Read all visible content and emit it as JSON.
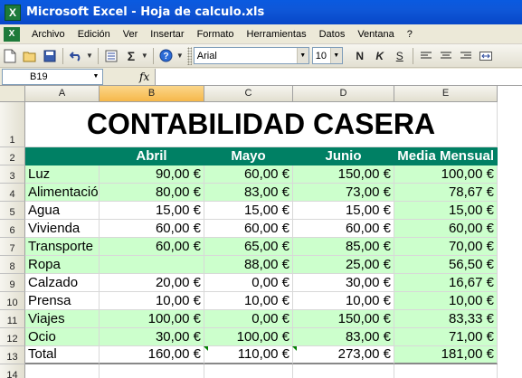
{
  "window": {
    "title": "Microsoft Excel - Hoja de calculo.xls",
    "app_icon": "X"
  },
  "menu": [
    "Archivo",
    "Edición",
    "Ver",
    "Insertar",
    "Formato",
    "Herramientas",
    "Datos",
    "Ventana",
    "?"
  ],
  "toolbar": {
    "font_name": "Arial",
    "font_size": "10",
    "bold_label": "N",
    "italic_label": "K",
    "underline_label": "S",
    "sum_label": "Σ",
    "help_label": "?"
  },
  "formula_bar": {
    "cell_ref": "B19",
    "fx_label": "fx",
    "formula": ""
  },
  "columns": [
    "A",
    "B",
    "C",
    "D",
    "E"
  ],
  "selected_column": "B",
  "sheet": {
    "title": "CONTABILIDAD CASERA",
    "headers": [
      "",
      "Abril",
      "Mayo",
      "Junio",
      "Media Mensual"
    ],
    "rows": [
      {
        "num": "3",
        "label": "Luz",
        "values": [
          "90,00 €",
          "60,00 €",
          "150,00 €",
          "100,00 €"
        ],
        "green": true
      },
      {
        "num": "4",
        "label": "Alimentación",
        "values": [
          "80,00 €",
          "83,00 €",
          "73,00 €",
          "78,67 €"
        ],
        "green": true
      },
      {
        "num": "5",
        "label": "Agua",
        "values": [
          "15,00 €",
          "15,00 €",
          "15,00 €",
          "15,00 €"
        ],
        "green": false
      },
      {
        "num": "6",
        "label": "Vivienda",
        "values": [
          "60,00 €",
          "60,00 €",
          "60,00 €",
          "60,00 €"
        ],
        "green": false
      },
      {
        "num": "7",
        "label": "Transporte",
        "values": [
          "60,00 €",
          "65,00 €",
          "85,00 €",
          "70,00 €"
        ],
        "green": true
      },
      {
        "num": "8",
        "label": "Ropa",
        "values": [
          "",
          "88,00 €",
          "25,00 €",
          "56,50 €"
        ],
        "green": true
      },
      {
        "num": "9",
        "label": "Calzado",
        "values": [
          "20,00 €",
          "0,00 €",
          "30,00 €",
          "16,67 €"
        ],
        "green": false
      },
      {
        "num": "10",
        "label": "Prensa",
        "values": [
          "10,00 €",
          "10,00 €",
          "10,00 €",
          "10,00 €"
        ],
        "green": false
      },
      {
        "num": "11",
        "label": "Viajes",
        "values": [
          "100,00 €",
          "0,00 €",
          "150,00 €",
          "83,33 €"
        ],
        "green": true
      },
      {
        "num": "12",
        "label": "Ocio",
        "values": [
          "30,00 €",
          "100,00 €",
          "83,00 €",
          "71,00 €"
        ],
        "green": true
      },
      {
        "num": "13",
        "label": "Total",
        "values": [
          "160,00 €",
          "110,00 €",
          "273,00 €",
          "181,00 €"
        ],
        "green": false
      }
    ],
    "extra_rows": [
      "14"
    ]
  },
  "colors": {
    "header_green": "#008064",
    "row_green": "#ccffcc",
    "selected_header": "#f6b84a"
  }
}
